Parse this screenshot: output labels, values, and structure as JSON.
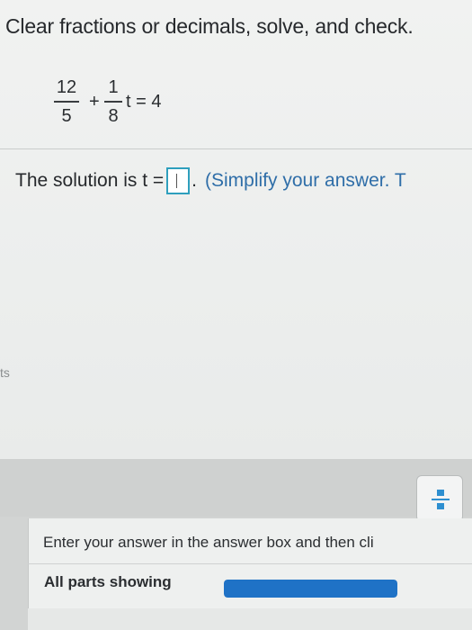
{
  "instruction": "Clear fractions or decimals, solve, and check.",
  "equation": {
    "term1": {
      "numerator": "12",
      "denominator": "5"
    },
    "operator": "+",
    "term2": {
      "numerator": "1",
      "denominator": "8"
    },
    "rest": "t = 4"
  },
  "solution": {
    "prefix": "The solution is t =",
    "answer_value": "",
    "period": ".",
    "hint": "(Simplify your answer. T"
  },
  "left_fragment": "ts",
  "status": {
    "message": "Enter your answer in the answer box and then cli",
    "parts_label": "All parts showing",
    "progress": 1.0
  },
  "colors": {
    "answer_box_border": "#2e9fbd",
    "hint_text": "#2f6ea8",
    "progress_fill": "#1f72c6"
  },
  "icons": {
    "fraction_button": "fraction-icon",
    "text_caret": "text-caret-icon"
  }
}
